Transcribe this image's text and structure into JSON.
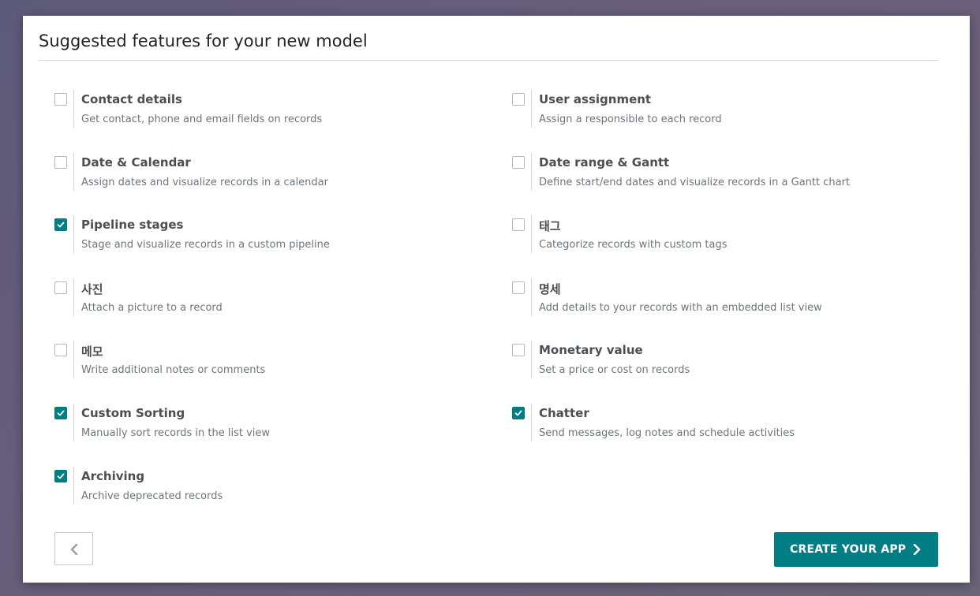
{
  "dialog": {
    "title": "Suggested features for your new model"
  },
  "features": [
    {
      "title": "Contact details",
      "description": "Get contact, phone and email fields on records",
      "checked": false
    },
    {
      "title": "User assignment",
      "description": "Assign a responsible to each record",
      "checked": false
    },
    {
      "title": "Date & Calendar",
      "description": "Assign dates and visualize records in a calendar",
      "checked": false
    },
    {
      "title": "Date range & Gantt",
      "description": "Define start/end dates and visualize records in a Gantt chart",
      "checked": false
    },
    {
      "title": "Pipeline stages",
      "description": "Stage and visualize records in a custom pipeline",
      "checked": true
    },
    {
      "title": "태그",
      "description": "Categorize records with custom tags",
      "checked": false
    },
    {
      "title": "사진",
      "description": "Attach a picture to a record",
      "checked": false
    },
    {
      "title": "명세",
      "description": "Add details to your records with an embedded list view",
      "checked": false
    },
    {
      "title": "메모",
      "description": "Write additional notes or comments",
      "checked": false
    },
    {
      "title": "Monetary value",
      "description": "Set a price or cost on records",
      "checked": false
    },
    {
      "title": "Custom Sorting",
      "description": "Manually sort records in the list view",
      "checked": true
    },
    {
      "title": "Chatter",
      "description": "Send messages, log notes and schedule activities",
      "checked": true
    },
    {
      "title": "Archiving",
      "description": "Archive deprecated records",
      "checked": true
    }
  ],
  "footer": {
    "back_icon": "chevron-left-icon",
    "create_label": "CREATE YOUR APP",
    "create_icon": "chevron-right-icon"
  },
  "colors": {
    "accent": "#017e84",
    "title_text": "#212529",
    "feature_title": "#4a4f55",
    "feature_desc": "#6c757d"
  }
}
